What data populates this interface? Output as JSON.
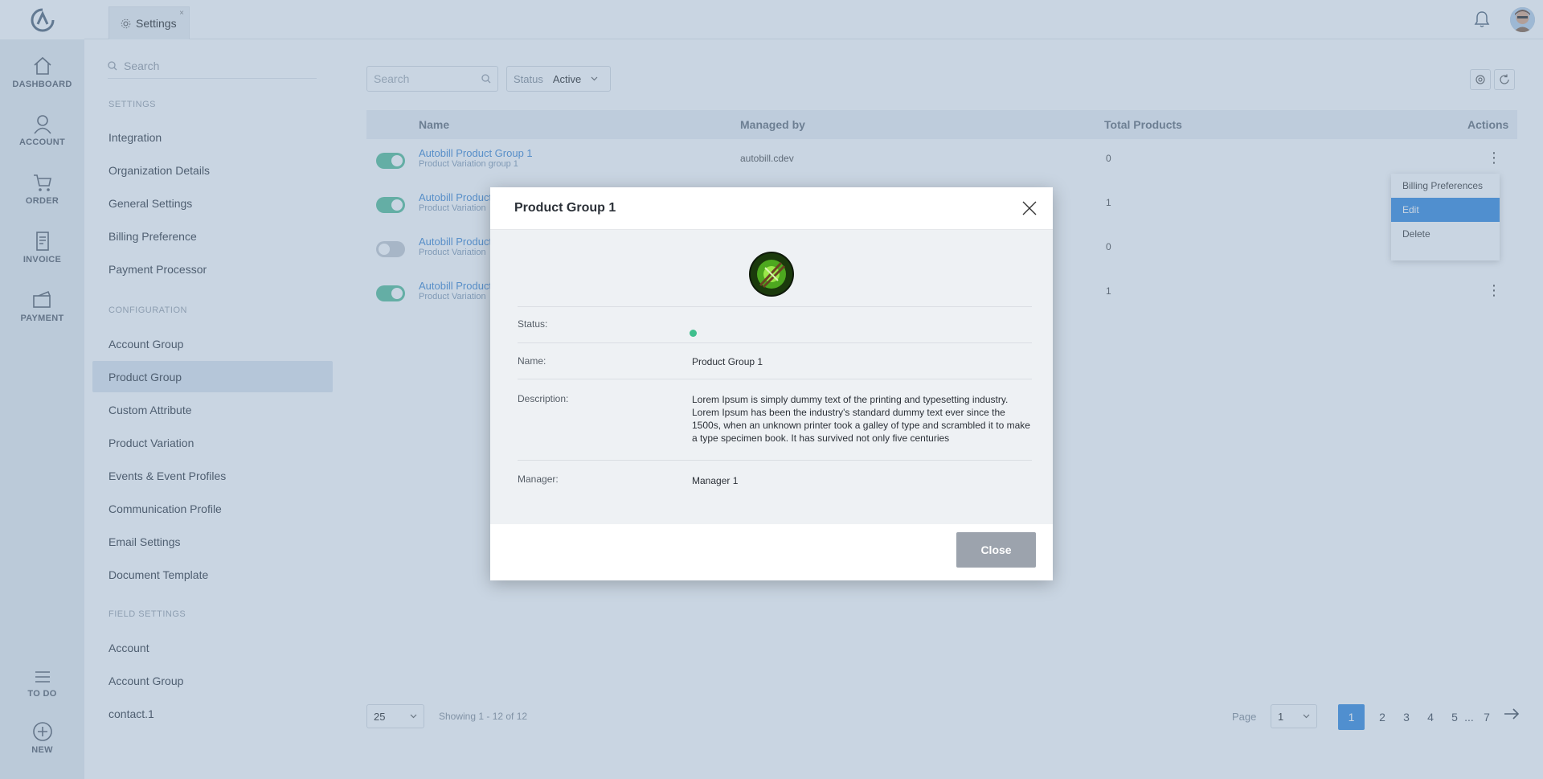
{
  "topbar": {
    "tab_label": "Settings",
    "tab_close": "×"
  },
  "leftnav": {
    "items": [
      {
        "label": "DASHBOARD",
        "icon": "home-icon"
      },
      {
        "label": "ACCOUNT",
        "icon": "user-icon"
      },
      {
        "label": "ORDER",
        "icon": "cart-icon"
      },
      {
        "label": "INVOICE",
        "icon": "invoice-icon"
      },
      {
        "label": "PAYMENT",
        "icon": "payment-icon"
      }
    ],
    "bottom": [
      {
        "label": "TO DO",
        "icon": "list-icon"
      },
      {
        "label": "NEW",
        "icon": "plus-circle-icon"
      }
    ]
  },
  "sidebar": {
    "search_placeholder": "Search",
    "settings_heading": "SETTINGS",
    "settings_items": [
      "Integration",
      "Organization Details",
      "General Settings",
      "Billing Preference",
      "Payment Processor"
    ],
    "configuration_heading": "CONFIGURATION",
    "configuration_items": [
      "Account Group",
      "Product Group",
      "Custom Attribute",
      "Product Variation",
      "Events & Event Profiles",
      "Communication Profile",
      "Email Settings",
      "Document Template"
    ],
    "field_settings_heading": "FIELD SETTINGS",
    "field_settings_items": [
      "Account",
      "Account Group",
      "contact.1"
    ]
  },
  "main": {
    "search_placeholder": "Search",
    "status_label": "Status",
    "status_value": "Active",
    "columns": [
      "Name",
      "Managed by",
      "Total Products",
      "Actions"
    ],
    "rows": [
      {
        "name": "Autobill Product Group 1",
        "sub": "Product Variation group 1",
        "managed_by": "autobill.cdev",
        "total": "0",
        "enabled": true
      },
      {
        "name": "Autobill Product",
        "sub": "Product Variation",
        "managed_by": "",
        "total": "1",
        "enabled": true
      },
      {
        "name": "Autobill Product",
        "sub": "Product Variation",
        "managed_by": "",
        "total": "0",
        "enabled": false
      },
      {
        "name": "Autobill Product",
        "sub": "Product Variation",
        "managed_by": "",
        "total": "1",
        "enabled": true
      }
    ],
    "dropdown": [
      "Billing Preferences",
      "Edit",
      "Delete"
    ],
    "pager": {
      "size": "25",
      "showing": "Showing 1 - 12 of 12",
      "page_label": "Page",
      "page_value": "1",
      "pages": [
        "1",
        "2",
        "3",
        "4",
        "5",
        "...",
        "7"
      ]
    }
  },
  "modal": {
    "title": "Product Group 1",
    "status_label": "Status:",
    "name_label": "Name:",
    "name_value": "Product Group  1",
    "description_label": "Description:",
    "description_value": "Lorem Ipsum is simply dummy text of the printing and typesetting industry. Lorem Ipsum has been the industry's standard dummy text ever since the 1500s, when an unknown printer took a galley of type and scrambled it to make a type specimen book. It has survived not only five centuries",
    "manager_label": "Manager:",
    "manager_value": "Manager 1",
    "close_button": "Close",
    "status_color": "#3fbf8d"
  }
}
